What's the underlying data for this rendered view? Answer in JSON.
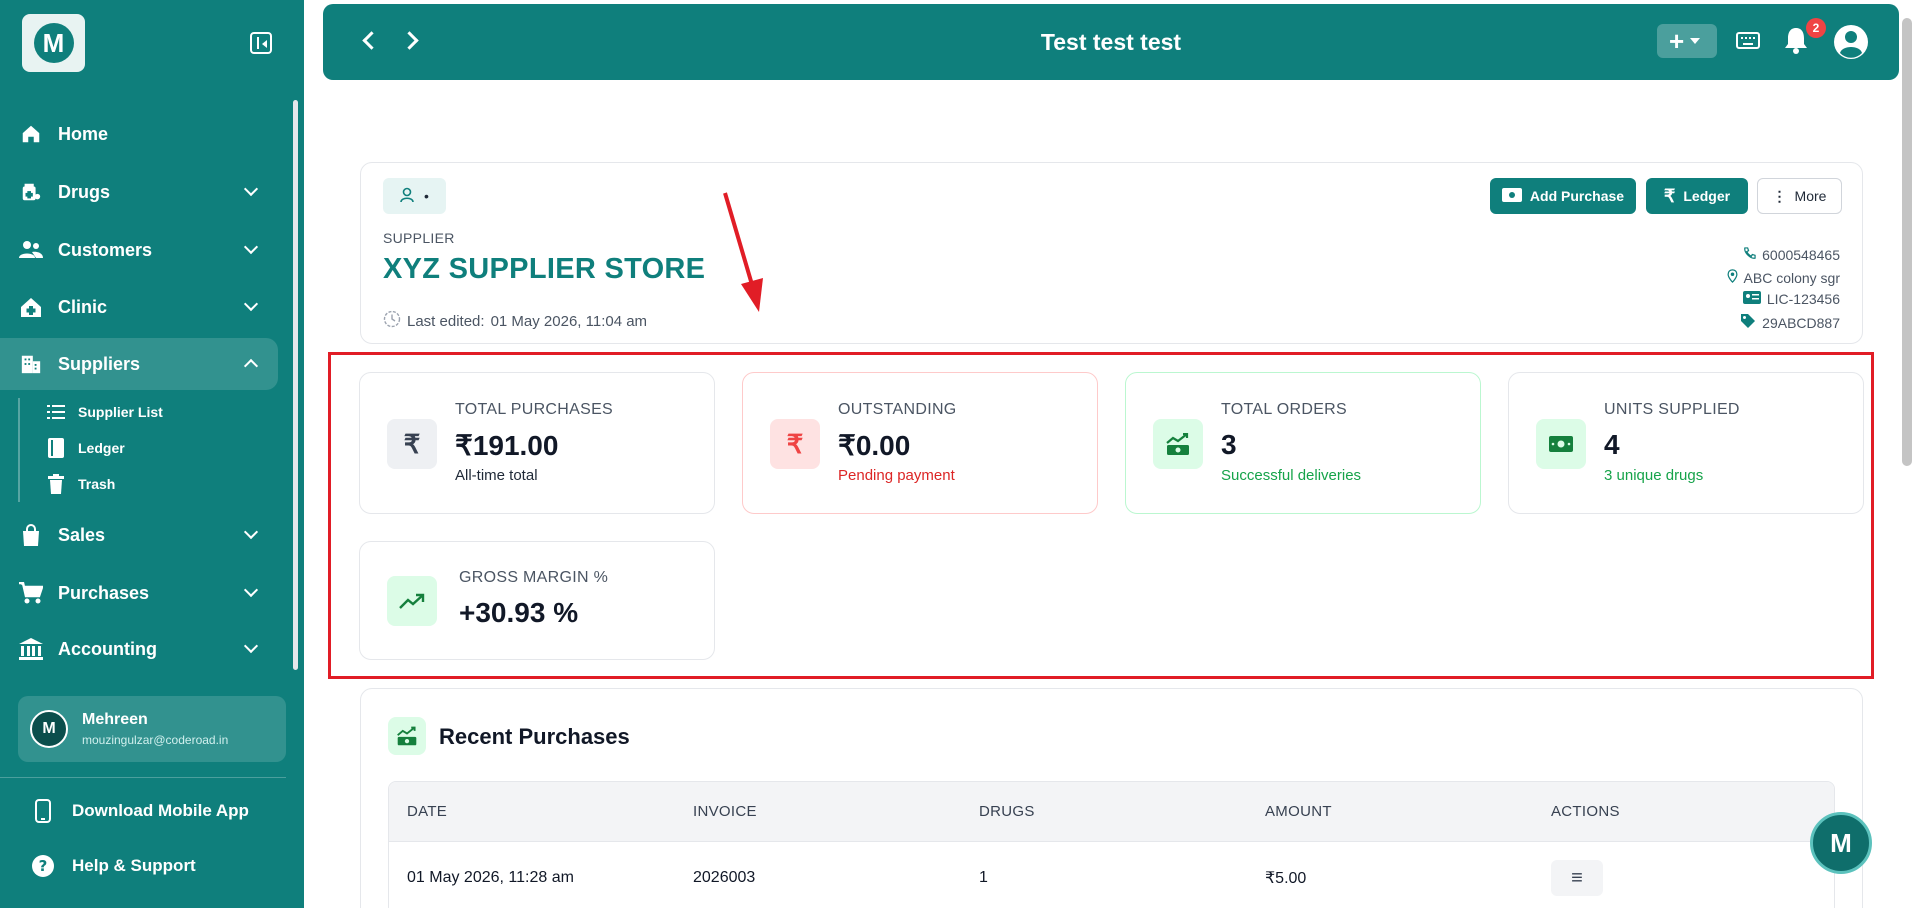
{
  "sidebar": {
    "logo": "M",
    "items": [
      {
        "label": "Home",
        "icon": "home-icon"
      },
      {
        "label": "Drugs",
        "icon": "drugs-icon"
      },
      {
        "label": "Customers",
        "icon": "customers-icon"
      },
      {
        "label": "Clinic",
        "icon": "clinic-icon"
      },
      {
        "label": "Suppliers",
        "icon": "suppliers-icon"
      },
      {
        "label": "Sales",
        "icon": "sales-icon"
      },
      {
        "label": "Purchases",
        "icon": "cart-icon"
      },
      {
        "label": "Accounting",
        "icon": "bank-icon"
      }
    ],
    "sub_items": [
      {
        "label": "Supplier List",
        "icon": "list-icon"
      },
      {
        "label": "Ledger",
        "icon": "book-icon"
      },
      {
        "label": "Trash",
        "icon": "trash-icon"
      }
    ],
    "user": {
      "initial": "M",
      "name": "Mehreen",
      "email": "mouzingulzar@coderoad.in"
    },
    "download_label": "Download Mobile App",
    "help_label": "Help & Support"
  },
  "header": {
    "title": "Test test test",
    "notification_count": "2"
  },
  "supplier": {
    "tag_dot": "•",
    "label": "SUPPLIER",
    "name": "XYZ SUPPLIER STORE",
    "last_edited_label": "Last edited:",
    "last_edited_value": "01 May 2026, 11:04 am",
    "add_purchase_label": "Add Purchase",
    "ledger_label": "Ledger",
    "more_label": "More",
    "phone": "6000548465",
    "address": "ABC colony sgr",
    "license": "LIC-123456",
    "gst": "29ABCD887"
  },
  "stats": [
    {
      "label": "TOTAL PURCHASES",
      "value": "₹191.00",
      "sub": "All-time total",
      "icon": "rupee-icon"
    },
    {
      "label": "OUTSTANDING",
      "value": "₹0.00",
      "sub": "Pending payment",
      "icon": "rupee-icon"
    },
    {
      "label": "TOTAL ORDERS",
      "value": "3",
      "sub": "Successful deliveries",
      "icon": "money-chart-icon"
    },
    {
      "label": "UNITS SUPPLIED",
      "value": "4",
      "sub": "3 unique drugs",
      "icon": "cash-icon"
    },
    {
      "label": "GROSS MARGIN %",
      "value": "+30.93 %",
      "icon": "trending-up-icon"
    }
  ],
  "recent": {
    "title": "Recent Purchases",
    "columns": [
      "DATE",
      "INVOICE",
      "DRUGS",
      "AMOUNT",
      "ACTIONS"
    ],
    "rows": [
      {
        "date": "01 May 2026, 11:28 am",
        "invoice": "2026003",
        "drugs": "1",
        "amount": "₹5.00"
      }
    ]
  },
  "colors": {
    "brand": "#0f7f7c",
    "danger": "#dc2626",
    "success": "#16a34a",
    "annotation": "#e11d26"
  }
}
